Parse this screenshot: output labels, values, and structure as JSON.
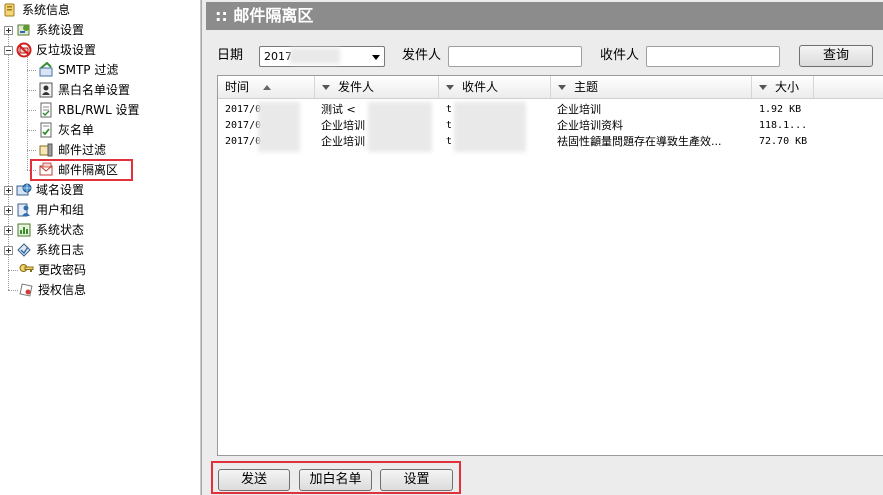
{
  "tree": {
    "items": [
      {
        "label": "系统信息",
        "icon": "info-folder-icon"
      },
      {
        "label": "系统设置",
        "icon": "settings-gear-icon"
      },
      {
        "label": "反垃圾设置",
        "icon": "anti-spam-icon"
      },
      {
        "label": "SMTP 过滤",
        "icon": "smtp-filter-icon"
      },
      {
        "label": "黑白名单设置",
        "icon": "user-list-icon"
      },
      {
        "label": "RBL/RWL 设置",
        "icon": "rbl-document-icon"
      },
      {
        "label": "灰名单",
        "icon": "greylist-document-icon"
      },
      {
        "label": "邮件过滤",
        "icon": "mail-filter-icon"
      },
      {
        "label": "邮件隔离区",
        "icon": "mail-quarantine-icon"
      },
      {
        "label": "域名设置",
        "icon": "domain-globe-icon"
      },
      {
        "label": "用户和组",
        "icon": "users-groups-icon"
      },
      {
        "label": "系统状态",
        "icon": "system-status-icon"
      },
      {
        "label": "系统日志",
        "icon": "system-log-icon"
      },
      {
        "label": "更改密码",
        "icon": "change-password-icon"
      },
      {
        "label": "授权信息",
        "icon": "license-icon"
      }
    ]
  },
  "panel": {
    "title": ":: 邮件隔离区",
    "filter": {
      "date_label": "日期",
      "date_value": "2017-",
      "sender_label": "发件人",
      "sender_value": "",
      "recipient_label": "收件人",
      "recipient_value": "",
      "query_button": "查询"
    },
    "columns": [
      "时间",
      "发件人",
      "收件人",
      "主题",
      "大小"
    ],
    "rows": [
      {
        "time": "2017/0",
        "sender": "测试 <",
        "recipient": "t",
        "subject": "企业培训",
        "size": "1.92 KB"
      },
      {
        "time": "2017/0",
        "sender": "企业培训",
        "recipient": "t",
        "subject": "企业培训资料",
        "size": "118.1..."
      },
      {
        "time": "2017/0",
        "sender": "企业培训",
        "recipient": "t",
        "subject": "祛固性龥量問題存在導致生產效...",
        "size": "72.70 KB"
      }
    ],
    "actions": {
      "send": "发送",
      "whitelist": "加白名单",
      "settings": "设置"
    }
  },
  "colors": {
    "title_bar": "#8c8c8c",
    "highlight": "#e0323a",
    "panel_bg": "#ececec"
  }
}
